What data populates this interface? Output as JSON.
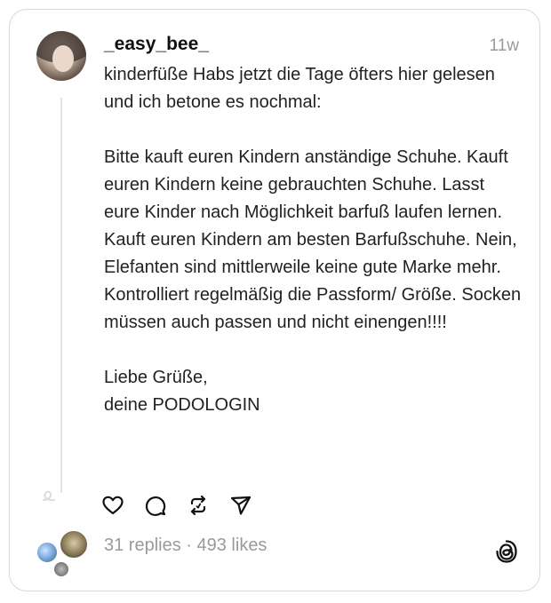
{
  "post": {
    "username": "_easy_bee_",
    "time": "11w",
    "text": "kinderfüße Habs jetzt die Tage öfters hier gelesen und ich betone es nochmal:\n\nBitte kauft euren Kindern anständige Schuhe. Kauft euren Kindern keine gebrauchten Schuhe. Lasst eure Kinder nach Möglichkeit barfuß laufen lernen. Kauft euren Kindern am besten Barfußschuhe. Nein, Elefanten sind mittlerweile keine gute Marke mehr. Kontrolliert regelmäßig die Passform/ Größe. Socken müssen auch passen und nicht einengen!!!!\n\nLiebe Grüße,\ndeine PODOLOGIN",
    "replies_text": "31 replies",
    "separator": " · ",
    "likes_text": "493 likes"
  },
  "actions": {
    "icons": [
      "heart-icon",
      "comment-icon",
      "repost-icon",
      "share-icon"
    ]
  },
  "colors": {
    "text": "#222222",
    "muted": "#9a9a9a",
    "border": "#d9d9d9",
    "thread_line": "#e3e3e3"
  }
}
